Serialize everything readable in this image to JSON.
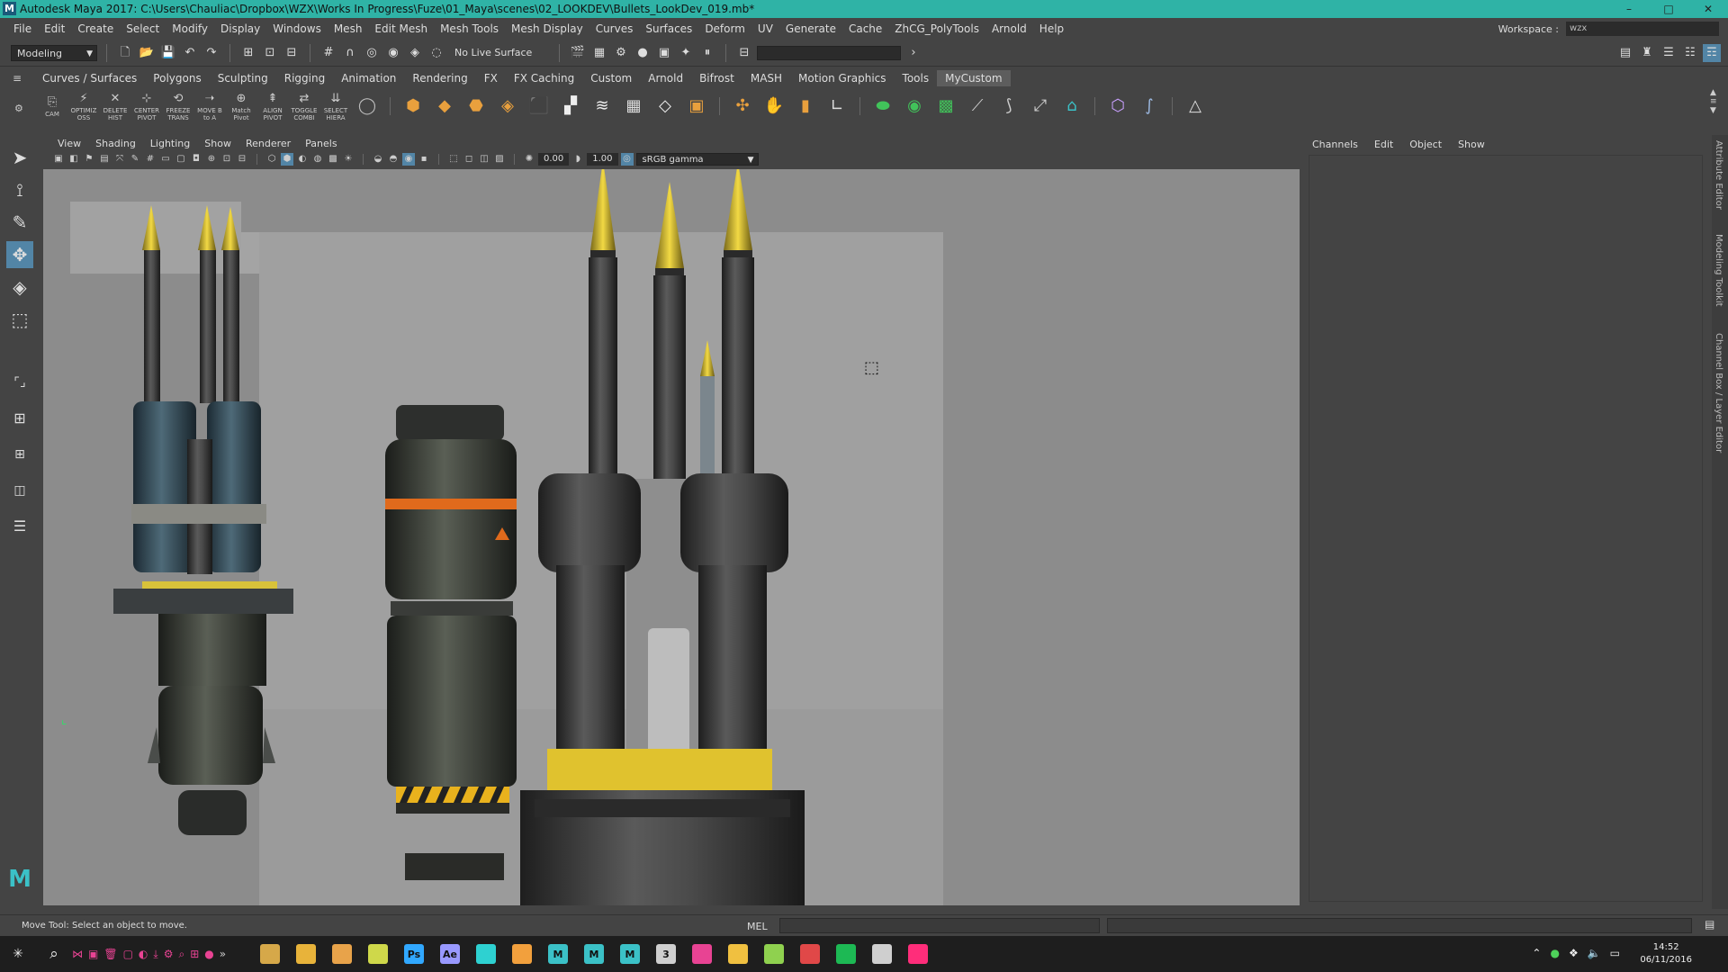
{
  "window": {
    "title": "Autodesk Maya 2017: C:\\Users\\Chauliac\\Dropbox\\WZX\\Works In Progress\\Fuze\\01_Maya\\scenes\\02_LOOKDEV\\Bullets_LookDev_019.mb*",
    "logo": "M"
  },
  "menubar": [
    "File",
    "Edit",
    "Create",
    "Select",
    "Modify",
    "Display",
    "Windows",
    "Mesh",
    "Edit Mesh",
    "Mesh Tools",
    "Mesh Display",
    "Curves",
    "Surfaces",
    "Deform",
    "UV",
    "Generate",
    "Cache",
    "ZhCG_PolyTools",
    "Arnold",
    "Help"
  ],
  "workspace": {
    "label": "Workspace :",
    "value": "wzx"
  },
  "statusline": {
    "mode": "Modeling",
    "live_surface": "No Live Surface"
  },
  "shelf_tabs": [
    "Curves / Surfaces",
    "Polygons",
    "Sculpting",
    "Rigging",
    "Animation",
    "Rendering",
    "FX",
    "FX Caching",
    "Custom",
    "Arnold",
    "Bifrost",
    "MASH",
    "Motion Graphics",
    "Tools",
    "MyCustom"
  ],
  "shelf_active": "MyCustom",
  "shelf_buttons": [
    {
      "label": "CAM",
      "icon": "camera-icon"
    },
    {
      "label": "OPTIMIZ OSS",
      "icon": "optimize-icon"
    },
    {
      "label": "DELETE HIST",
      "icon": "delete-history-icon"
    },
    {
      "label": "CENTER PIVOT",
      "icon": "center-pivot-icon"
    },
    {
      "label": "FREEZE TRANS",
      "icon": "freeze-transform-icon"
    },
    {
      "label": "MOVE B to A",
      "icon": "move-b-to-a-icon"
    },
    {
      "label": "Match Pivot",
      "icon": "match-pivot-icon"
    },
    {
      "label": "ALIGN PIVOT",
      "icon": "align-pivot-icon"
    },
    {
      "label": "TOGGLE COMBI",
      "icon": "toggle-combine-icon"
    },
    {
      "label": "SELECT HIERA",
      "icon": "select-hierarchy-icon"
    }
  ],
  "panel_menu": [
    "View",
    "Shading",
    "Lighting",
    "Show",
    "Renderer",
    "Panels"
  ],
  "panel_tools": {
    "exposure": "0.00",
    "gamma": "1.00",
    "color_space": "sRGB gamma"
  },
  "channel_box": {
    "menu": [
      "Channels",
      "Edit",
      "Object",
      "Show"
    ]
  },
  "side_tabs": [
    "Attribute Editor",
    "Modeling Toolkit",
    "Channel Box / Layer Editor"
  ],
  "helpline": {
    "message": "Move Tool: Select an object to move.",
    "mel_label": "MEL"
  },
  "taskbar": {
    "time": "14:52",
    "date": "06/11/2016",
    "apps": [
      {
        "name": "file-explorer",
        "label": "",
        "color": "#d6a849"
      },
      {
        "name": "chrome",
        "label": "",
        "color": "#e8b33a"
      },
      {
        "name": "notes",
        "label": "",
        "color": "#e8a34a"
      },
      {
        "name": "app-green",
        "label": "",
        "color": "#cfd84a"
      },
      {
        "name": "photoshop",
        "label": "Ps",
        "color": "#31a8ff"
      },
      {
        "name": "after-effects",
        "label": "Ae",
        "color": "#9999ff"
      },
      {
        "name": "app-cyan",
        "label": "",
        "color": "#2ed1d1"
      },
      {
        "name": "app-orange",
        "label": "",
        "color": "#f2a03d"
      },
      {
        "name": "maya-1",
        "label": "M",
        "color": "#3bc1c7"
      },
      {
        "name": "maya-2",
        "label": "M",
        "color": "#3bc1c7"
      },
      {
        "name": "maya-3",
        "label": "M",
        "color": "#3bc1c7"
      },
      {
        "name": "3ds-max",
        "label": "3",
        "color": "#cfcfcf"
      },
      {
        "name": "substance",
        "label": "",
        "color": "#e84393"
      },
      {
        "name": "app-yellow",
        "label": "",
        "color": "#f0c040"
      },
      {
        "name": "app-lime",
        "label": "",
        "color": "#8fd14f"
      },
      {
        "name": "app-red",
        "label": "",
        "color": "#e04848"
      },
      {
        "name": "spotify",
        "label": "",
        "color": "#1db954"
      },
      {
        "name": "task-manager",
        "label": "",
        "color": "#cfcfcf"
      },
      {
        "name": "app-pink",
        "label": "",
        "color": "#ff2d7a"
      }
    ]
  },
  "colors": {
    "titlebar": "#2fb3a6",
    "active_tool": "#5285a6",
    "viewport_bg": "#8c8c8c"
  }
}
